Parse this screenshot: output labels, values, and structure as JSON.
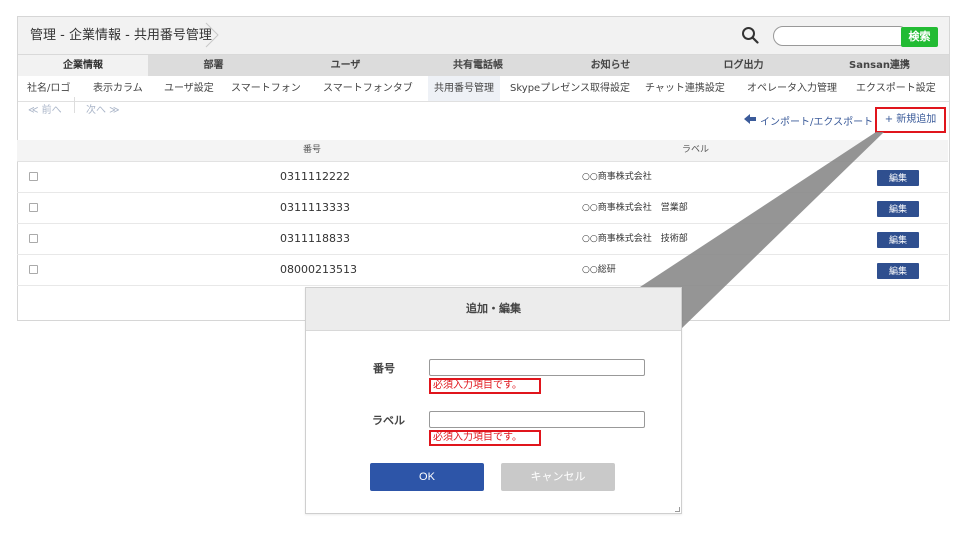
{
  "header": {
    "breadcrumb": "管理 - 企業情報 - 共用番号管理",
    "search_placeholder": "",
    "search_button": "検索"
  },
  "tabs": [
    {
      "label": "企業情報",
      "active": true
    },
    {
      "label": "部署",
      "active": false
    },
    {
      "label": "ユーザ",
      "active": false
    },
    {
      "label": "共有電話帳",
      "active": false
    },
    {
      "label": "お知らせ",
      "active": false
    },
    {
      "label": "ログ出力",
      "active": false
    },
    {
      "label": "Sansan連携",
      "active": false
    }
  ],
  "subtabs": [
    {
      "label": "社名/ロゴ",
      "active": false
    },
    {
      "label": "表示カラム",
      "active": false
    },
    {
      "label": "ユーザ設定",
      "active": false
    },
    {
      "label": "スマートフォン",
      "active": false
    },
    {
      "label": "スマートフォンタブ",
      "active": false
    },
    {
      "label": "共用番号管理",
      "active": true
    },
    {
      "label": "Skypeプレゼンス取得設定",
      "active": false
    },
    {
      "label": "チャット連携設定",
      "active": false
    },
    {
      "label": "オペレータ入力管理",
      "active": false
    },
    {
      "label": "エクスポート設定",
      "active": false
    }
  ],
  "toolbar": {
    "prev": "≪ 前へ",
    "next": "次へ ≫",
    "import_export": "インポート/エクスポート",
    "add_new": "+ 新規追加"
  },
  "table": {
    "headers": {
      "number": "番号",
      "label": "ラベル"
    },
    "rows": [
      {
        "number": "0311112222",
        "label": "○○商事株式会社",
        "edit": "編集"
      },
      {
        "number": "0311113333",
        "label": "○○商事株式会社　営業部",
        "edit": "編集"
      },
      {
        "number": "0311118833",
        "label": "○○商事株式会社　技術部",
        "edit": "編集"
      },
      {
        "number": "08000213513",
        "label": "○○総研",
        "edit": "編集"
      }
    ]
  },
  "dialog": {
    "title": "追加・編集",
    "number_label": "番号",
    "label_label": "ラベル",
    "required_msg": "必須入力項目です。",
    "ok": "OK",
    "cancel": "キャンセル"
  },
  "colors": {
    "accent_green": "#22bb33",
    "primary_blue": "#2d55a8",
    "highlight_red": "#e0151c"
  }
}
